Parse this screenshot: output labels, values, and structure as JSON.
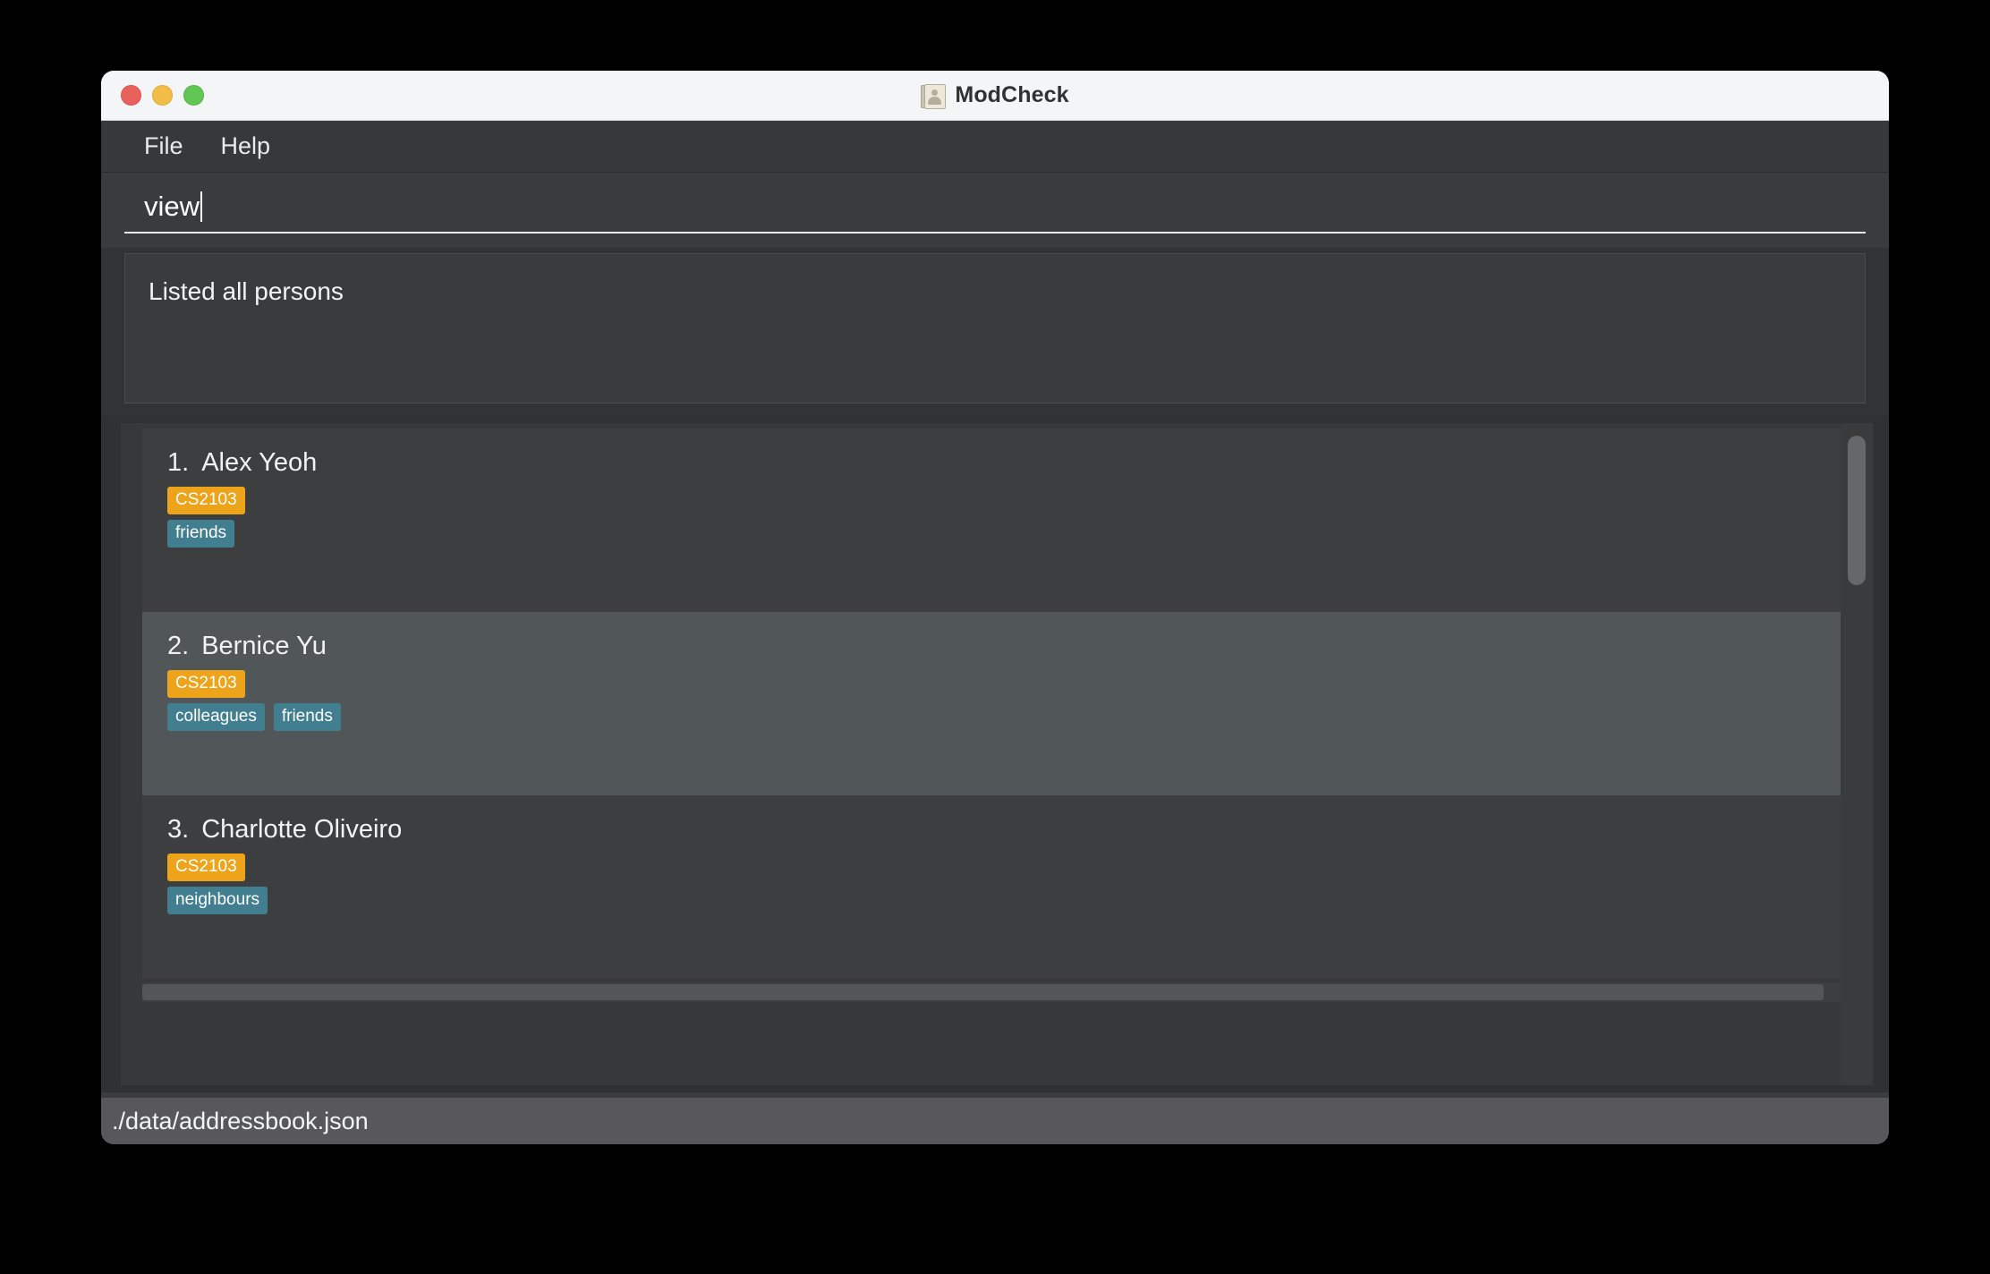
{
  "window": {
    "title": "ModCheck",
    "icon": "address-book-person-icon",
    "traffic_lights": {
      "close_label": "close",
      "minimize_label": "minimize",
      "maximize_label": "maximize",
      "close_color": "#e8615a",
      "minimize_color": "#f2bd46",
      "maximize_color": "#62c655"
    }
  },
  "menubar": {
    "items": [
      {
        "label": "File"
      },
      {
        "label": "Help"
      }
    ]
  },
  "command": {
    "value": "view",
    "placeholder": "Enter command here..."
  },
  "result": {
    "text": "Listed all persons"
  },
  "colors": {
    "module_tag": "#eda31a",
    "person_tag": "#417e8f",
    "selected_row": "#515659",
    "card_background": "#3c3e40",
    "window_background": "#3a3b3d"
  },
  "person_list": [
    {
      "index": "1.",
      "name": "Alex Yeoh",
      "module_tags": [
        "CS2103"
      ],
      "person_tags": [
        "friends"
      ],
      "selected": false
    },
    {
      "index": "2.",
      "name": "Bernice Yu",
      "module_tags": [
        "CS2103"
      ],
      "person_tags": [
        "colleagues",
        "friends"
      ],
      "selected": true
    },
    {
      "index": "3.",
      "name": "Charlotte Oliveiro",
      "module_tags": [
        "CS2103"
      ],
      "person_tags": [
        "neighbours"
      ],
      "selected": false
    }
  ],
  "statusbar": {
    "save_location": "./data/addressbook.json"
  }
}
